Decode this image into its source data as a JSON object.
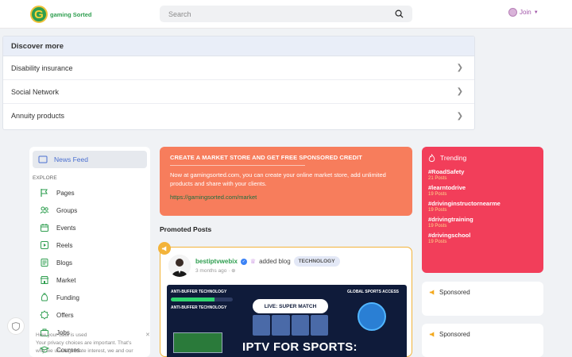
{
  "header": {
    "logo_letter": "G",
    "logo_text_1": "gaming",
    "logo_text_2": "Sorted",
    "search_placeholder": "Search",
    "join_label": "Join"
  },
  "discover": {
    "title": "Discover more",
    "items": [
      {
        "label": "Disability insurance"
      },
      {
        "label": "Social Network"
      },
      {
        "label": "Annuity products"
      }
    ]
  },
  "sidebar": {
    "active": "News Feed",
    "section_label": "EXPLORE",
    "items": [
      {
        "label": "Pages",
        "icon": "flag-icon"
      },
      {
        "label": "Groups",
        "icon": "groups-icon"
      },
      {
        "label": "Events",
        "icon": "calendar-icon"
      },
      {
        "label": "Reels",
        "icon": "reels-icon"
      },
      {
        "label": "Blogs",
        "icon": "blog-icon"
      },
      {
        "label": "Market",
        "icon": "market-icon"
      },
      {
        "label": "Funding",
        "icon": "funding-icon"
      },
      {
        "label": "Offers",
        "icon": "offers-icon"
      },
      {
        "label": "Jobs",
        "icon": "jobs-icon"
      },
      {
        "label": "Courses",
        "icon": "courses-icon"
      }
    ]
  },
  "cookie": {
    "line1": "How your data is used",
    "line2": "Your privacy choices are important. That's",
    "line3": "why we use legitimate interest, we and our"
  },
  "promo": {
    "title": "CREATE A MARKET STORE AND GET FREE SPONSORED CREDIT",
    "text": "Now at gamingsorted.com, you can create your online market store, add unlimited products and share with your clients.",
    "link": "https://gamingsorted.com/market"
  },
  "promoted_label": "Promoted Posts",
  "post": {
    "user": "bestiptvwebix",
    "action": "added blog",
    "tag": "TECHNOLOGY",
    "time": "3 months ago",
    "image": {
      "left_label_1": "ANTI-BUFFER TECHNOLOGY",
      "left_label_2": "ANTI-BUFFER TECHNOLOGY",
      "live_label": "LIVE: SUPER MATCH",
      "right_label": "GLOBAL SPORTS ACCESS",
      "title": "IPTV FOR SPORTS:",
      "progress": 0.7
    }
  },
  "trending": {
    "title": "Trending",
    "items": [
      {
        "tag": "#RoadSafety",
        "count": "21 Posts"
      },
      {
        "tag": "#learntodrive",
        "count": "19 Posts"
      },
      {
        "tag": "#drivinginstructornearme",
        "count": "19 Posts"
      },
      {
        "tag": "#drivingtraining",
        "count": "19 Posts"
      },
      {
        "tag": "#drivingschool",
        "count": "19 Posts"
      }
    ]
  },
  "sponsored": [
    {
      "label": "Sponsored"
    },
    {
      "label": "Sponsored"
    }
  ],
  "colors": {
    "brand_green": "#2e9e4f",
    "promo": "#f77d5c",
    "trending": "#f23e5a",
    "accent_blue": "#4a6fd0"
  }
}
